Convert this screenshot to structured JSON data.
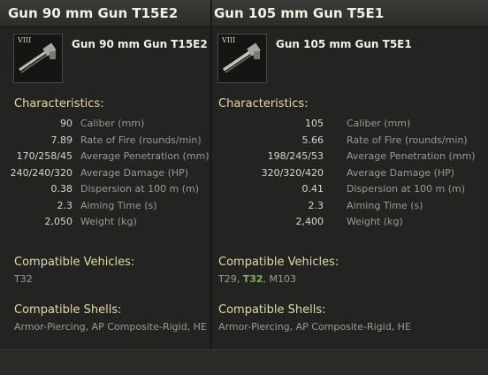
{
  "left": {
    "header": "Gun 90 mm Gun T15E2",
    "tier": "VIII",
    "name": "Gun 90 mm Gun T15E2",
    "characteristics_title": "Characteristics:",
    "stats": [
      {
        "value": "90",
        "label": "Caliber (mm)"
      },
      {
        "value": "7.89",
        "label": "Rate of Fire (rounds/min)"
      },
      {
        "value": "170/258/45",
        "label": "Average Penetration (mm)"
      },
      {
        "value": "240/240/320",
        "label": "Average Damage (HP)"
      },
      {
        "value": "0.38",
        "label": "Dispersion at 100 m (m)"
      },
      {
        "value": "2.3",
        "label": "Aiming Time (s)"
      },
      {
        "value": "2,050",
        "label": "Weight (kg)"
      }
    ],
    "vehicles_title": "Compatible Vehicles:",
    "vehicles": [
      "T32"
    ],
    "shells_title": "Compatible Shells:",
    "shells": "Armor-Piercing, AP Composite-Rigid, HE"
  },
  "right": {
    "header": "Gun 105 mm Gun T5E1",
    "tier": "VIII",
    "name": "Gun 105 mm Gun T5E1",
    "characteristics_title": "Characteristics:",
    "stats": [
      {
        "value": "105",
        "label": "Caliber (mm)"
      },
      {
        "value": "5.66",
        "label": "Rate of Fire (rounds/min)"
      },
      {
        "value": "198/245/53",
        "label": "Average Penetration (mm)"
      },
      {
        "value": "320/320/420",
        "label": "Average Damage (HP)"
      },
      {
        "value": "0.41",
        "label": "Dispersion at 100 m (m)"
      },
      {
        "value": "2.3",
        "label": "Aiming Time (s)"
      },
      {
        "value": "2,400",
        "label": "Weight (kg)"
      }
    ],
    "vehicles_title": "Compatible Vehicles:",
    "vehicles": [
      "T29",
      "T32",
      "M103"
    ],
    "vehicles_separator": ", ",
    "highlighted_vehicle": "T32",
    "shells_title": "Compatible Shells:",
    "shells": "Armor-Piercing, AP Composite-Rigid, HE"
  },
  "colors": {
    "section_title": "#e6d9a6",
    "highlight_vehicle": "#7fb05a",
    "panel_bg": "#232321"
  },
  "icons": {
    "gun_icon": "gun-icon"
  }
}
